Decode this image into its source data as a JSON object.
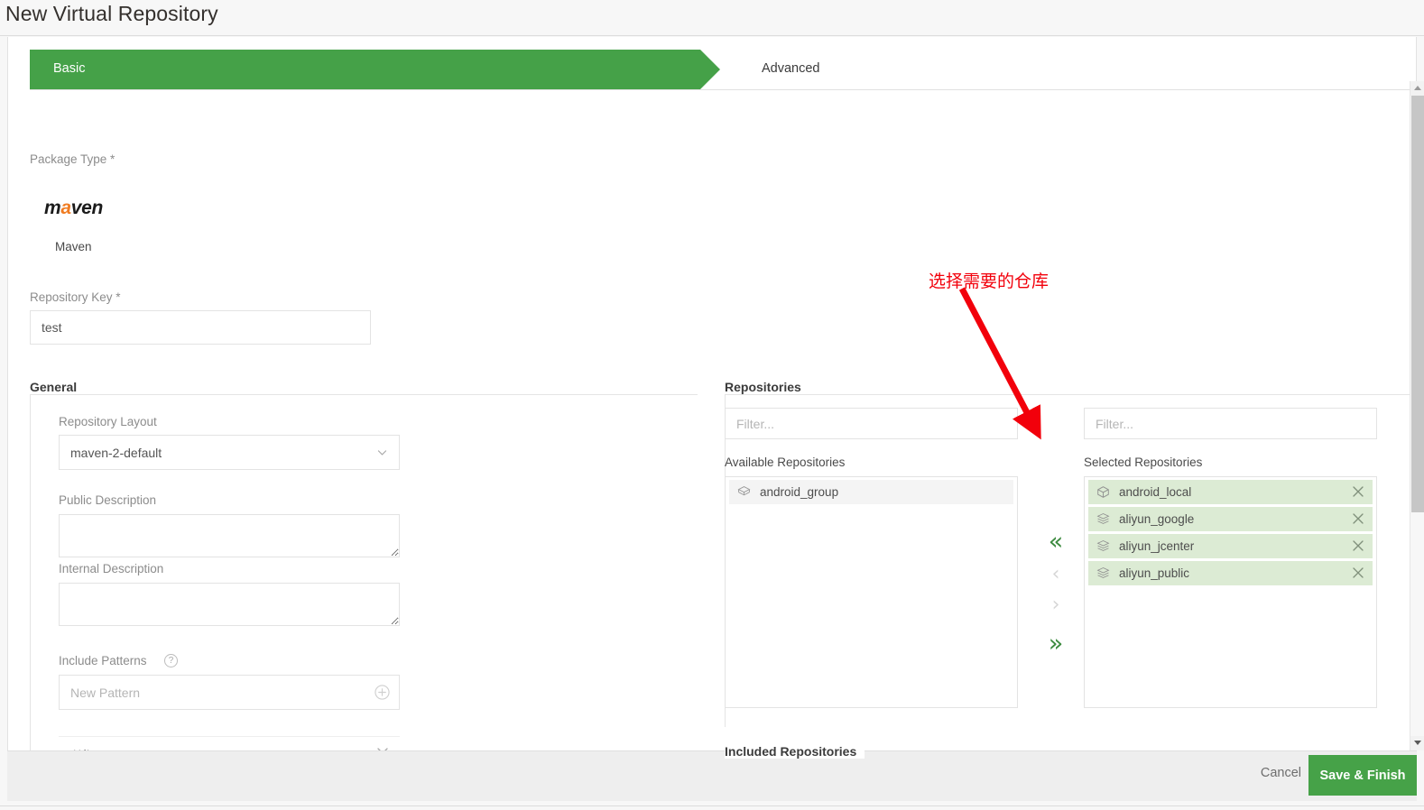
{
  "page": {
    "title": "New Virtual Repository"
  },
  "wizard": {
    "tabs": [
      {
        "label": "Basic",
        "active": true
      },
      {
        "label": "Advanced",
        "active": false
      }
    ]
  },
  "package_type": {
    "label": "Package Type *",
    "logo_parts": {
      "pre": "m",
      "accent": "a",
      "post": "ven"
    },
    "selected_name": "Maven"
  },
  "repository_key": {
    "label": "Repository Key *",
    "value": "test",
    "placeholder": ""
  },
  "general": {
    "title": "General",
    "repository_layout": {
      "label": "Repository Layout",
      "value": "maven-2-default"
    },
    "public_description": {
      "label": "Public Description",
      "value": "",
      "placeholder": ""
    },
    "internal_description": {
      "label": "Internal Description",
      "value": "",
      "placeholder": ""
    },
    "include_patterns": {
      "label": "Include Patterns",
      "help_glyph": "?",
      "new_pattern_placeholder": "New Pattern",
      "new_pattern_value": "",
      "patterns": [
        "**/*"
      ]
    }
  },
  "repositories": {
    "title": "Repositories",
    "left_filter_placeholder": "Filter...",
    "left_filter_value": "",
    "right_filter_placeholder": "Filter...",
    "right_filter_value": "",
    "available_label": "Available Repositories",
    "selected_label": "Selected Repositories",
    "available": [
      {
        "name": "android_group",
        "icon": "repo-group-icon"
      }
    ],
    "selected": [
      {
        "name": "android_local",
        "icon": "repo-local-icon",
        "remove_glyph": "✕"
      },
      {
        "name": "aliyun_google",
        "icon": "repo-remote-icon",
        "remove_glyph": "✕"
      },
      {
        "name": "aliyun_jcenter",
        "icon": "repo-remote-icon",
        "remove_glyph": "✕"
      },
      {
        "name": "aliyun_public",
        "icon": "repo-remote-icon",
        "remove_glyph": "✕"
      }
    ],
    "transfer": {
      "move_all_left": "«",
      "move_left": "‹",
      "move_right": "›",
      "move_all_right": "»"
    }
  },
  "included_repositories": {
    "title": "Included Repositories"
  },
  "annotation": {
    "text": "选择需要的仓库",
    "color": "#f2000b"
  },
  "footer": {
    "cancel_label": "Cancel",
    "save_label": "Save & Finish"
  },
  "colors": {
    "brand_green": "#45a148",
    "selected_row_green": "#dcebd4",
    "arrow_green": "#3d8b40",
    "annotation_red": "#f2000b"
  }
}
